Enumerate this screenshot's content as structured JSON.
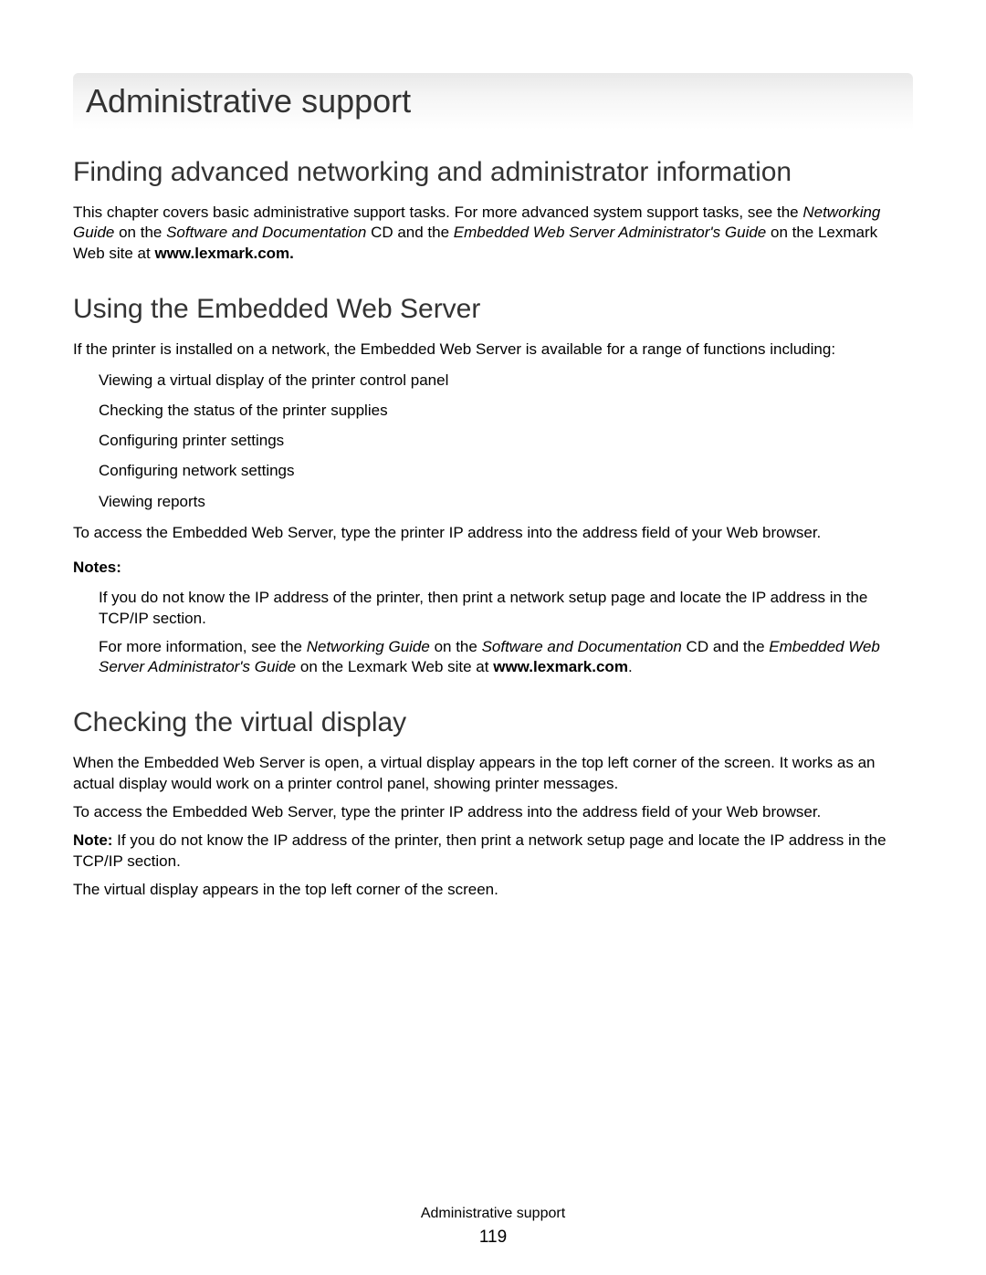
{
  "chapter": {
    "title": "Administrative support"
  },
  "section1": {
    "title": "Finding advanced networking and administrator information",
    "p1_a": "This chapter covers basic administrative support tasks. For more advanced system support tasks, see the ",
    "p1_b": "Networking Guide",
    "p1_c": " on the ",
    "p1_d": "Software and Documentation",
    "p1_e": " CD and the ",
    "p1_f": "Embedded Web Server Administrator's Guide",
    "p1_g": " on the Lexmark Web site at ",
    "p1_h": "www.lexmark.com."
  },
  "section2": {
    "title": "Using the Embedded Web Server",
    "p1": "If the printer is installed on a network, the Embedded Web Server is available for a range of functions including:",
    "bullets": [
      "Viewing a virtual display of the printer control panel",
      "Checking the status of the printer supplies",
      "Configuring printer settings",
      "Configuring network settings",
      "Viewing reports"
    ],
    "p2": "To access the Embedded Web Server, type the printer IP address into the address field of your Web browser.",
    "notesLabel": "Notes:",
    "note1": "If you do not know the IP address of the printer, then print a network setup page and locate the IP address in the TCP/IP section.",
    "note2_a": "For more information, see the ",
    "note2_b": "Networking Guide",
    "note2_c": " on the ",
    "note2_d": "Software and Documentation",
    "note2_e": " CD and the ",
    "note2_f": "Embedded Web Server Administrator's Guide",
    "note2_g": " on the Lexmark Web site at ",
    "note2_h": "www.lexmark.com",
    "note2_i": "."
  },
  "section3": {
    "title": "Checking the virtual display",
    "p1": "When the Embedded Web Server is open, a virtual display appears in the top left corner of the screen. It works as an actual display would work on a printer control panel, showing printer messages.",
    "p2": "To access the Embedded Web Server, type the printer IP address into the address field of your Web browser.",
    "p3_a": "Note:",
    "p3_b": " If you do not know the IP address of the printer, then print a network setup page and locate the IP address in the TCP/IP section.",
    "p4": "The virtual display appears in the top left corner of the screen."
  },
  "footer": {
    "title": "Administrative support",
    "page": "119"
  }
}
